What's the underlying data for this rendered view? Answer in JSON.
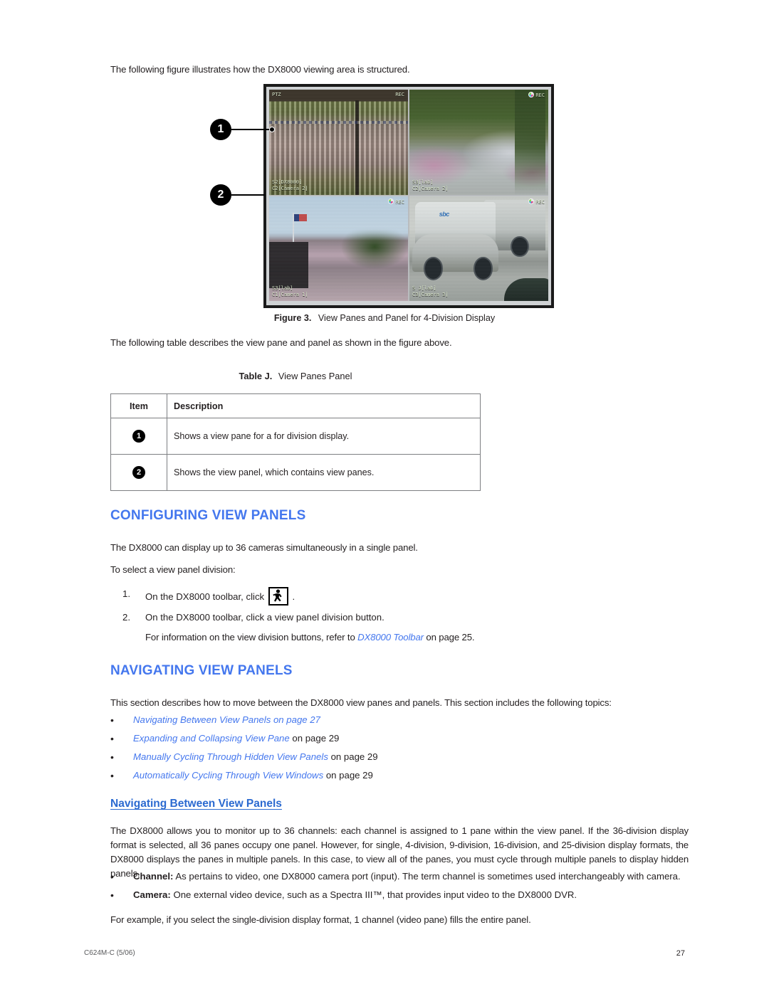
{
  "document": {
    "footer_left": "C624M-C (5/06)",
    "footer_page": "27"
  },
  "intro": {
    "line1": "The following figure illustrates how the DX8000 viewing area is structured.",
    "line2": "The following table describes the view pane and panel as shown in the figure above."
  },
  "figure": {
    "caption_label": "Figure 3.",
    "caption_text": "View Panes and Panel for 4-Division Display",
    "callouts": [
      {
        "number": "1"
      },
      {
        "number": "2"
      }
    ],
    "panes": [
      {
        "id": "pane-1",
        "selected": true,
        "osd_top_left": "PTZ",
        "osd_top_right": "REC",
        "osd_bottom_1": "S2[DX8000]",
        "osd_bottom_2": "C2[Camera 2]"
      },
      {
        "id": "pane-2",
        "selected": false,
        "osd_top_left": "",
        "osd_top_right": "REC",
        "osd_bottom_1": "S3[lab]",
        "osd_bottom_2": "C2[Camera 2]"
      },
      {
        "id": "pane-3",
        "selected": false,
        "osd_top_left": "",
        "osd_top_right": "REC",
        "osd_bottom_1": "S3[lab]",
        "osd_bottom_2": "C1[Camera 1]"
      },
      {
        "id": "pane-4",
        "selected": false,
        "osd_top_left": "",
        "osd_top_right": "REC",
        "osd_bottom_1": "S J[lab]",
        "osd_bottom_2": "C3[Camera 3]",
        "vehicle_logo": "sbc"
      }
    ]
  },
  "table": {
    "caption_label": "Table J.",
    "caption_text": "View Panes Panel",
    "headers": [
      "Item",
      "Description"
    ],
    "rows": [
      {
        "item": "1",
        "description": "Shows a view pane for a for division display."
      },
      {
        "item": "2",
        "description": "Shows the view panel, which contains view panes."
      }
    ]
  },
  "sections": {
    "configuring": {
      "heading": "CONFIGURING VIEW PANELS",
      "paragraph": "The DX8000 can display up to 36 cameras simultaneously in a single panel.",
      "lead_in": "To select a view panel division:",
      "steps": [
        {
          "num": "1.",
          "before_icon": "On the DX8000 toolbar, click",
          "icon": "walking-person-icon",
          "after_icon": "."
        },
        {
          "num": "2.",
          "text": "On the DX8000 toolbar, click a view panel division button."
        }
      ],
      "step_note_before": "For information on the view division buttons, refer to ",
      "step_note_link": "DX8000 Toolbar",
      "step_note_after": " on page 25."
    },
    "navigating": {
      "heading": "NAVIGATING VIEW PANELS",
      "paragraph": "This section describes how to move between the DX8000 view panes and panels. This section includes the following topics:",
      "topics": [
        {
          "link": "Navigating Between View Panels on page 27",
          "suffix": "",
          "all_blue": true
        },
        {
          "link": "Expanding and Collapsing View Pane",
          "suffix": " on page 29",
          "all_blue": false
        },
        {
          "link": "Manually Cycling Through Hidden View Panels",
          "suffix": " on page 29",
          "all_blue": false
        },
        {
          "link": "Automatically Cycling Through View Windows",
          "suffix": " on page 29",
          "all_blue": false
        }
      ],
      "subheading": "Navigating Between View Panels",
      "body_paragraph": "The DX8000 allows you to monitor up to 36 channels: each channel is assigned to 1 pane within the view panel. If the 36-division display format is selected, all 36 panes occupy one panel. However, for single, 4-division, 9-division, 16-division, and 25-division display formats, the DX8000 displays the panes in multiple panels. In this case, to view all of the panes, you must cycle through multiple panels to display hidden panels.",
      "definitions": [
        {
          "term": "Channel:",
          "text": " As pertains to video, one DX8000 camera port (input). The term channel is sometimes used interchangeably with camera."
        },
        {
          "term": "Camera:",
          "text": " One external video device, such as a Spectra III™, that provides input video to the DX8000 DVR."
        }
      ],
      "closing": "For example, if you select the single-division display format, 1 channel (video pane) fills the entire panel."
    }
  },
  "colors": {
    "heading_blue": "#4477ee",
    "subheading_blue": "#2b6ad0",
    "text_black": "#231f20",
    "selected_pane_border": "#e6a79c"
  }
}
